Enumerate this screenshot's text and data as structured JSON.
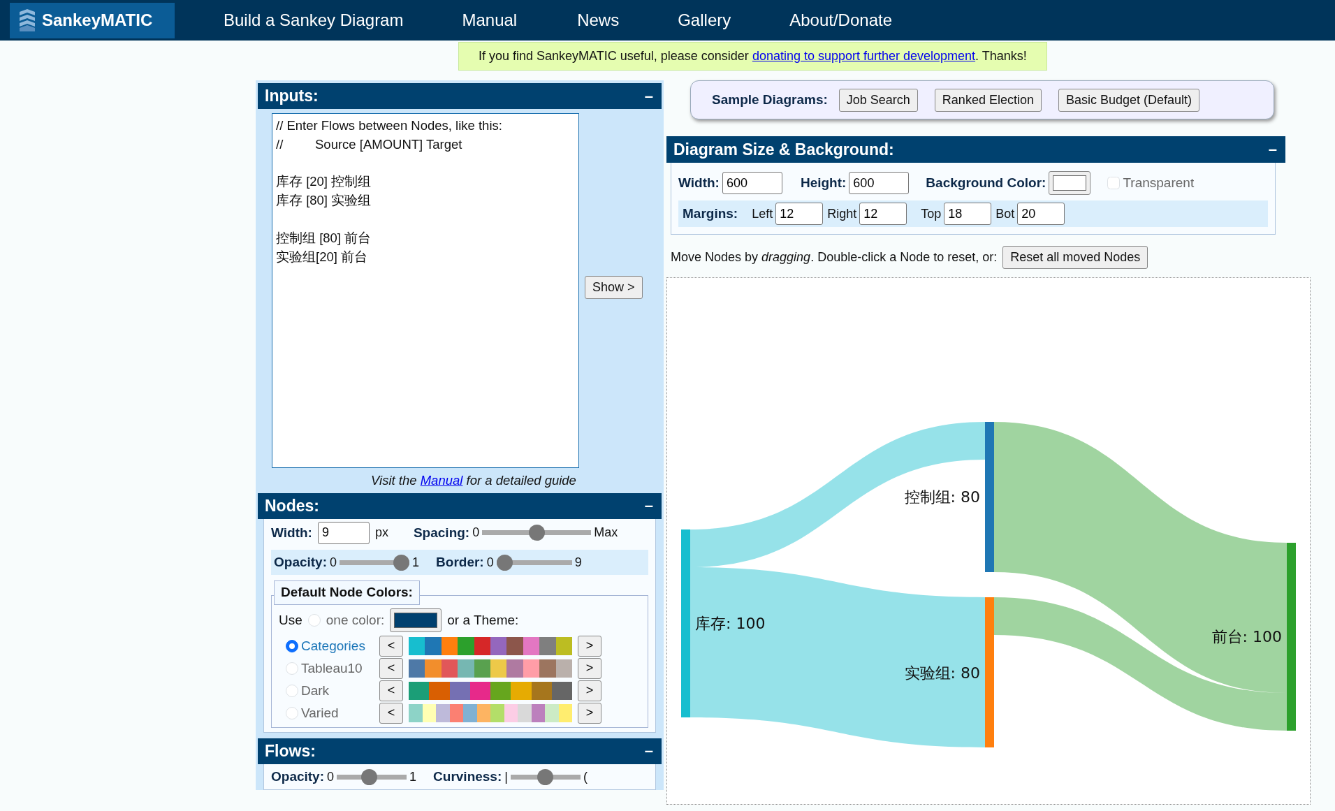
{
  "nav": {
    "brand": "SankeyMATIC",
    "links": [
      "Build a Sankey Diagram",
      "Manual",
      "News",
      "Gallery",
      "About/Donate"
    ]
  },
  "notice": {
    "before": "If you find SankeyMATIC useful, please consider ",
    "link": "donating to support further development",
    "after": ". Thanks!"
  },
  "inputs": {
    "title": "Inputs:",
    "collapse": "–",
    "comment": {
      "line1": "// Enter Flows between Nodes, like this:",
      "line2_prefix": "//",
      "line2": "Source [AMOUNT] Target"
    },
    "blocks": [
      [
        "库存 [20] 控制组",
        "库存 [80] 实验组"
      ],
      [
        "控制组 [80] 前台",
        "实验组[20] 前台"
      ]
    ],
    "show_button": "Show >",
    "guide": {
      "before": "Visit the ",
      "link": "Manual",
      "after": " for a detailed guide"
    }
  },
  "nodes": {
    "title": "Nodes:",
    "collapse": "–",
    "width": {
      "label": "Width:",
      "value": "9",
      "unit": "px"
    },
    "spacing": {
      "label": "Spacing:",
      "min": "0",
      "max": "Max",
      "level": 0.5
    },
    "opacity": {
      "label": "Opacity:",
      "min": "0",
      "max": "1",
      "level": 1
    },
    "border": {
      "label": "Border:",
      "min": "0",
      "max": "9",
      "level": 0
    },
    "colors": {
      "legend": "Default Node Colors:",
      "use": "Use",
      "one_color": {
        "label": "one color:",
        "selected": false,
        "color": "#00406f"
      },
      "theme_label": "or a Theme:",
      "themes": [
        {
          "label": "Categories",
          "selected": true,
          "prev": "<",
          "next": ">",
          "swatches": [
            {
              "color": "#17becf"
            },
            {
              "color": "#1f77b4"
            },
            {
              "color": "#ff7f0e"
            },
            {
              "color": "#2ca02c"
            },
            {
              "color": "#d62728"
            },
            {
              "color": "#9467bd"
            },
            {
              "color": "#8c564b"
            },
            {
              "color": "#e377c2"
            },
            {
              "color": "#7f7f7f"
            },
            {
              "color": "#bcbd22"
            }
          ]
        },
        {
          "label": "Tableau10",
          "selected": false,
          "prev": "<",
          "next": ">",
          "swatches": [
            {
              "color": "#4e79a7"
            },
            {
              "color": "#f28e2c"
            },
            {
              "color": "#e15759"
            },
            {
              "color": "#76b7b2"
            },
            {
              "color": "#59a14f"
            },
            {
              "color": "#edc949"
            },
            {
              "color": "#af7aa1"
            },
            {
              "color": "#ff9da7"
            },
            {
              "color": "#9c755f"
            },
            {
              "color": "#bab0ab"
            }
          ]
        },
        {
          "label": "Dark",
          "selected": false,
          "prev": "<",
          "next": ">",
          "swatches": [
            {
              "color": "#1b9e77"
            },
            {
              "color": "#d95f02"
            },
            {
              "color": "#7570b3"
            },
            {
              "color": "#e7298a"
            },
            {
              "color": "#66a61e"
            },
            {
              "color": "#e6ab02"
            },
            {
              "color": "#a6761d"
            },
            {
              "color": "#666666"
            }
          ]
        },
        {
          "label": "Varied",
          "selected": false,
          "prev": "<",
          "next": ">",
          "swatches": [
            {
              "color": "#8dd3c7"
            },
            {
              "color": "#ffffb3"
            },
            {
              "color": "#bebada"
            },
            {
              "color": "#fb8072"
            },
            {
              "color": "#80b1d3"
            },
            {
              "color": "#fdb462"
            },
            {
              "color": "#b3de69"
            },
            {
              "color": "#fccde5"
            },
            {
              "color": "#d9d9d9"
            },
            {
              "color": "#bc80bd"
            },
            {
              "color": "#ccebc5"
            },
            {
              "color": "#ffed6f"
            }
          ]
        }
      ]
    }
  },
  "flows": {
    "title": "Flows:",
    "collapse": "–",
    "opacity": {
      "label": "Opacity:",
      "min": "0",
      "max": "1",
      "level": 0.45
    },
    "curviness": {
      "label": "Curviness:",
      "min": "|",
      "max": "(",
      "level": 0.5
    }
  },
  "samples": {
    "label": "Sample Diagrams:",
    "buttons": [
      "Job Search",
      "Ranked Election",
      "Basic Budget (Default)"
    ]
  },
  "size": {
    "title": "Diagram Size & Background:",
    "collapse": "–",
    "width": {
      "label": "Width:",
      "value": "600"
    },
    "height": {
      "label": "Height:",
      "value": "600"
    },
    "background": {
      "label": "Background Color:",
      "color": "#ffffff"
    },
    "transparent": {
      "label": "Transparent",
      "checked": false
    },
    "margins": {
      "label": "Margins:",
      "fields": [
        {
          "label": "Left",
          "value": "12"
        },
        {
          "label": "Right",
          "value": "12"
        },
        {
          "label": "Top",
          "value": "18"
        },
        {
          "label": "Bot",
          "value": "20"
        }
      ]
    }
  },
  "move_hint": {
    "text": "Move Nodes by *dragging*. Double-click a Node to reset, or:",
    "reset_button": "Reset all moved Nodes"
  },
  "diagram": {
    "nodes": [
      {
        "label": "库存: 100",
        "color": "#17becf"
      },
      {
        "label": "控制组: 80",
        "color": "#1f77b4"
      },
      {
        "label": "实验组: 80",
        "color": "#ff7f0e"
      },
      {
        "label": "前台: 100",
        "color": "#2ca02c"
      }
    ]
  }
}
